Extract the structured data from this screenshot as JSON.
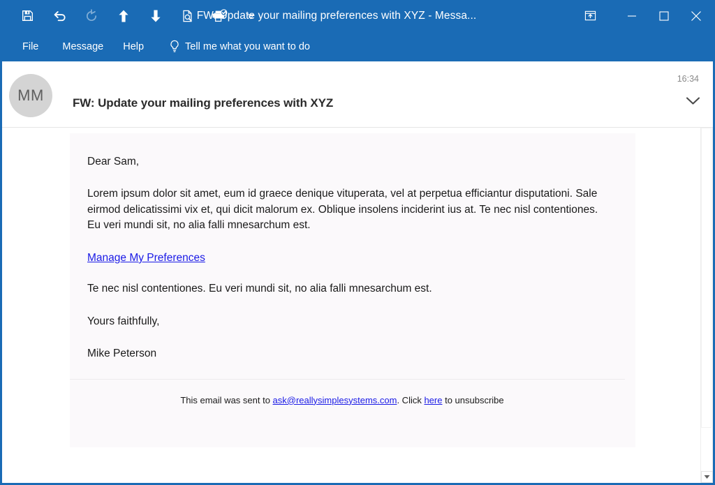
{
  "window": {
    "title": "FW: Update your mailing preferences with XYZ  -  Messa...",
    "accent_color": "#1a6bb5",
    "quick_access": [
      {
        "name": "save",
        "label": "Save"
      },
      {
        "name": "undo",
        "label": "Undo"
      },
      {
        "name": "redo",
        "label": "Redo"
      },
      {
        "name": "previous-item",
        "label": "Previous Item"
      },
      {
        "name": "next-item",
        "label": "Next Item"
      },
      {
        "name": "print-preview",
        "label": "Print Preview"
      },
      {
        "name": "quick-print",
        "label": "Quick Print"
      },
      {
        "name": "customize-quick-access-toolbar",
        "label": "Customize Quick Access Toolbar"
      }
    ],
    "controls": {
      "restore_up": "Restore Up",
      "minimize": "Minimize",
      "maximize": "Maximize",
      "close": "Close"
    }
  },
  "menubar": {
    "items": [
      {
        "label": "File"
      },
      {
        "label": "Message"
      },
      {
        "label": "Help"
      }
    ],
    "tell_me": "Tell me what you want to do"
  },
  "message": {
    "avatar_initials": "MM",
    "subject": "FW: Update your mailing preferences with XYZ",
    "timestamp": "16:34",
    "expand_label": "Expand"
  },
  "email": {
    "greeting": "Dear Sam,",
    "paragraph_1": "Lorem ipsum dolor sit amet, eum id graece denique vituperata, vel at perpetua efficiantur disputationi. Sale eirmod delicatissimi vix et, qui dicit malorum ex. Oblique insolens inciderint ius at. Te nec nisl contentiones. Eu veri mundi sit, no alia falli mnesarchum est.",
    "preferences_link": "Manage My Preferences",
    "paragraph_2": "Te nec nisl contentiones. Eu veri mundi sit, no alia falli mnesarchum est.",
    "sign_off": "Yours faithfully,",
    "sender_name": "Mike Peterson",
    "footer": {
      "prefix": "This email was sent to ",
      "email_link": "ask@reallysimplesystems.com",
      "middle": ". Click ",
      "here_link": "here",
      "suffix": " to unsubscribe"
    }
  },
  "scrollbar": {
    "down_arrow_label": "Scroll Down"
  }
}
